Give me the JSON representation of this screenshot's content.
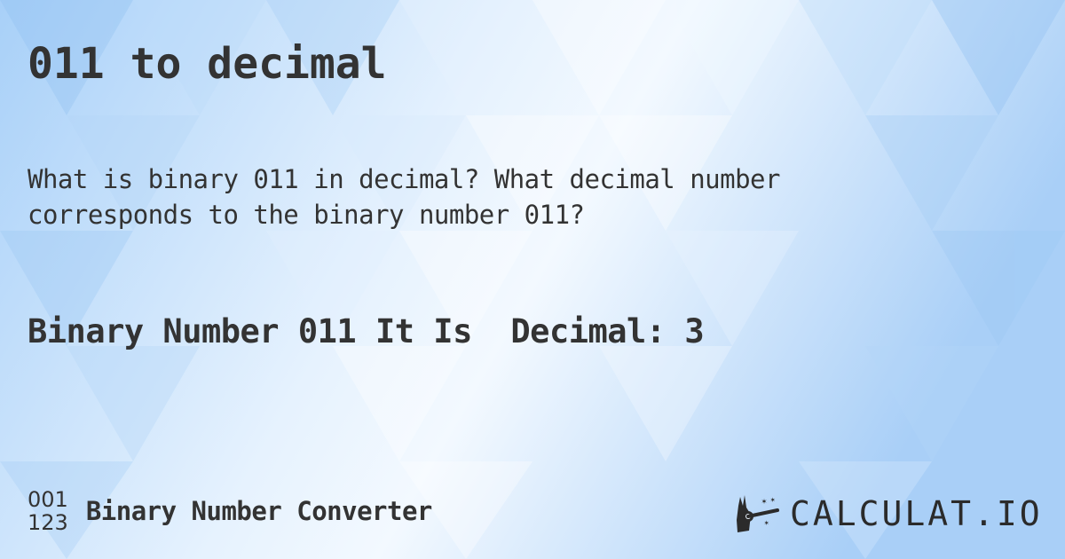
{
  "page": {
    "title": "011 to decimal",
    "question": "What is binary 011 in decimal? What decimal number corresponds to the binary number 011?",
    "answer": "Binary Number 011 It Is  Decimal: 3"
  },
  "footer": {
    "converter_icon_top": "001",
    "converter_icon_bottom": "123",
    "converter_label": "Binary Number Converter",
    "logo_text": "CALCULAT.IO",
    "logo_icon": "magic-wand-hand-icon"
  },
  "colors": {
    "text": "#333333",
    "background_light": "#f4f9ff",
    "background_mid": "#cfe4fb",
    "background_dark": "#9fcaf6"
  }
}
